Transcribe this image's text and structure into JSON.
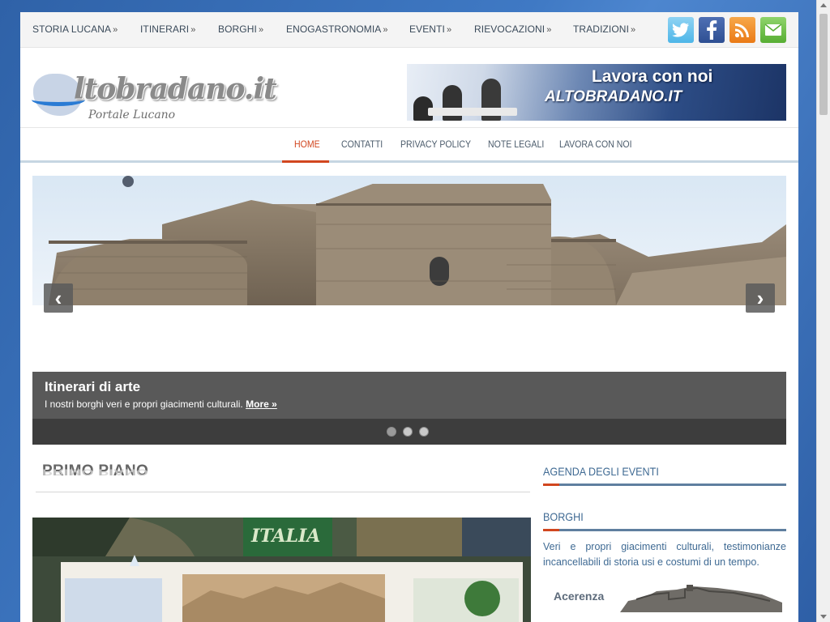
{
  "topnav": {
    "items": [
      {
        "label": "STORIA LUCANA",
        "arrow": "»"
      },
      {
        "label": "ITINERARI",
        "arrow": "»"
      },
      {
        "label": "BORGHI",
        "arrow": "»"
      },
      {
        "label": "ENOGASTRONOMIA",
        "arrow": "»"
      },
      {
        "label": "EVENTI",
        "arrow": "»"
      },
      {
        "label": "RIEVOCAZIONI",
        "arrow": "»"
      },
      {
        "label": "TRADIZIONI",
        "arrow": "»"
      }
    ],
    "social": [
      {
        "icon": "twitter-icon"
      },
      {
        "icon": "facebook-icon"
      },
      {
        "icon": "rss-icon"
      },
      {
        "icon": "mail-icon"
      }
    ]
  },
  "header": {
    "logo_brand": "ltobradano.it",
    "logo_tagline": "Portale Lucano",
    "banner_title": "Lavora con noi",
    "banner_subtitle": "ALTOBRADANO.IT"
  },
  "mainmenu": {
    "items": [
      {
        "label": "HOME",
        "active": true
      },
      {
        "label": "CONTATTI",
        "active": false
      },
      {
        "label": "PRIVACY POLICY",
        "active": false
      },
      {
        "label": "NOTE LEGALI",
        "active": false
      },
      {
        "label": "LAVORA CON NOI",
        "active": false
      }
    ]
  },
  "slider": {
    "prev": "‹",
    "next": "›",
    "caption_title": "Itinerari di arte",
    "caption_text": "I nostri borghi veri e propri giacimenti culturali.",
    "caption_more": "More »",
    "dot_count": 3,
    "active_dot": 1
  },
  "primo_piano": {
    "title": "PRIMO PIANO"
  },
  "sidebar": {
    "agenda_title": "AGENDA DEGLI EVENTI",
    "borghi_title": "BORGHI",
    "borghi_text": "Veri e propri giacimenti culturali, testimonianze incancellabili di storia usi e costumi di un tempo.",
    "borgo_name": "Acerenza"
  },
  "colors": {
    "accent": "#d1461f",
    "link_blue": "#3f6a93",
    "background": "#3f79c4"
  }
}
